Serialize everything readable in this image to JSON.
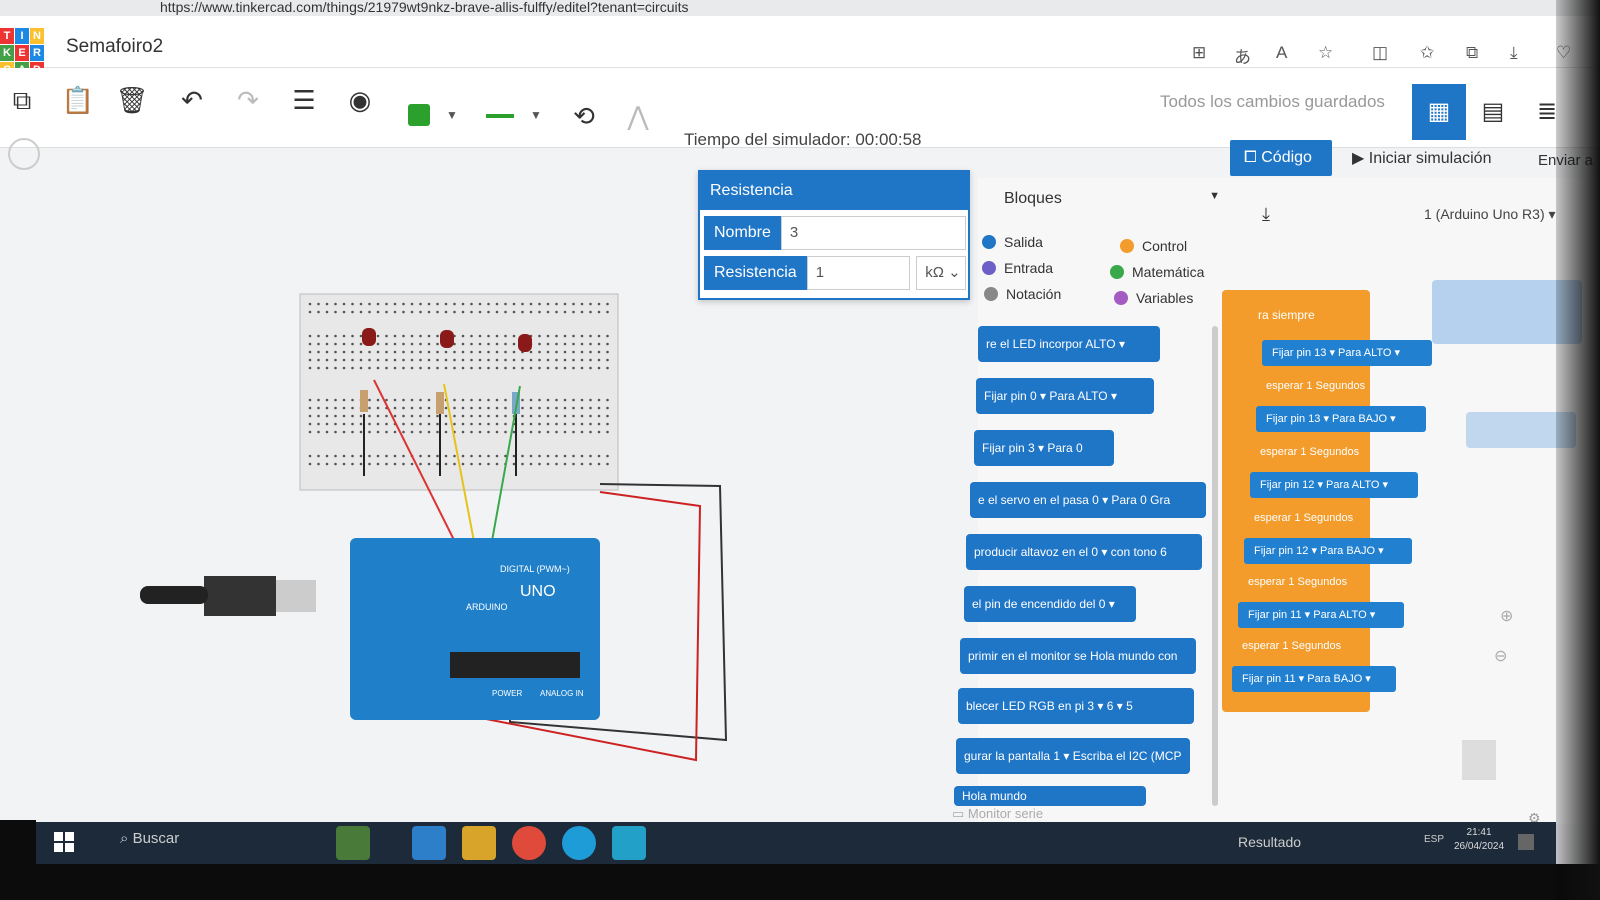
{
  "browser": {
    "url": "https://www.tinkercad.com/things/21979wt9nkz-brave-allis-fulffy/editel?tenant=circuits"
  },
  "logo": {
    "letters": [
      "T",
      "I",
      "N",
      "K",
      "E",
      "R",
      "C",
      "A",
      "D"
    ],
    "colors": [
      "#e33",
      "#1e88e5",
      "#fbc02d",
      "#43a047",
      "#e33",
      "#1e88e5",
      "#fbc02d",
      "#43a047",
      "#e33"
    ]
  },
  "header": {
    "project_name": "Semafoiro2",
    "saved_status": "Todos los cambios guardados"
  },
  "toolbar": {
    "sim_time": "Tiempo del simulador: 00:00:58",
    "code_label": "Código",
    "start_sim_label": "Iniciar simulación",
    "send_label": "Enviar a"
  },
  "inspector": {
    "title": "Resistencia",
    "name_label": "Nombre",
    "name_value": "3",
    "res_label": "Resistencia",
    "res_value": "1",
    "unit": "kΩ"
  },
  "editor": {
    "mode": "Bloques",
    "board": "1 (Arduino Uno R3)",
    "categories": [
      {
        "label": "Salida",
        "color": "#1f75c6"
      },
      {
        "label": "Control",
        "color": "#f39c2c"
      },
      {
        "label": "Entrada",
        "color": "#6c5fc7"
      },
      {
        "label": "Matemática",
        "color": "#38a84a"
      },
      {
        "label": "Notación",
        "color": "#888888"
      },
      {
        "label": "Variables",
        "color": "#a45cc2"
      }
    ],
    "palette": [
      "re el LED incorpor  ALTO ▾",
      "Fijar pin  0 ▾  Para  ALTO ▾",
      "Fijar pin  3 ▾  Para  0",
      "e el servo en el pasa  0 ▾  Para  0  Gra",
      "producir altavoz en el  0 ▾  con tono  6",
      "el pin de encendido del  0 ▾",
      "primir en el monitor se  Hola mundo  con",
      "blecer LED RGB en pi  3 ▾  6 ▾  5",
      "gurar la pantalla  1 ▾  Escriba el  I2C (MCP",
      "Hola mundo"
    ],
    "loop_label": "ra siempre",
    "script": [
      "Fijar pin  13 ▾  Para  ALTO ▾",
      "esperar  1  Segundos",
      "Fijar pin  13 ▾  Para  BAJO ▾",
      "esperar  1  Segundos",
      "Fijar pin  12 ▾  Para  ALTO ▾",
      "esperar  1  Segundos",
      "Fijar pin  12 ▾  Para  BAJO ▾",
      "esperar  1  Segundos",
      "Fijar pin  11 ▾  Para  ALTO ▾",
      "esperar  1  Segundos",
      "Fijar pin  11 ▾  Para  BAJO ▾"
    ],
    "monitor_label": "Monitor serie"
  },
  "circuit": {
    "board_labels": [
      "DIGITAL (PWM~)",
      "UNO",
      "ARDUINO",
      "POWER",
      "ANALOG IN"
    ]
  },
  "taskbar": {
    "search": "Buscar",
    "result": "Resultado",
    "time": "21:41",
    "date": "26/04/2024",
    "lang": "ESP"
  }
}
